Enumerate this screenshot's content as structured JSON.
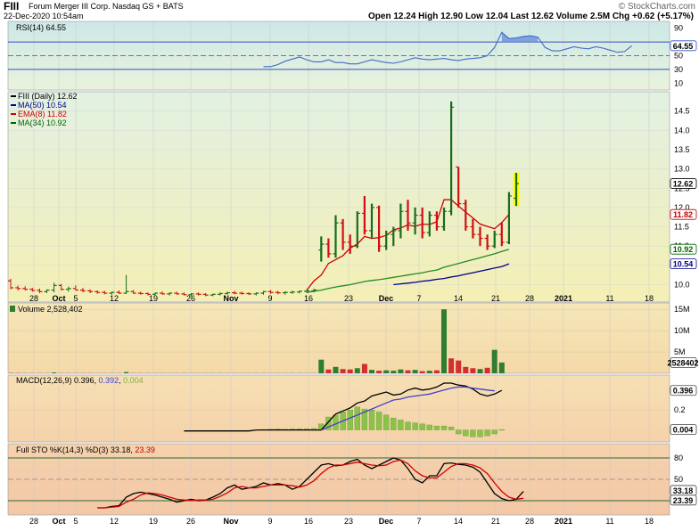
{
  "header": {
    "symbol": "FIII",
    "company": "Forum Merger III Corp. Nasdaq GS + BATS",
    "datetime": "22-Dec-2020 10:54am",
    "watermark": "© StockCharts.com",
    "quote_text": "Open 12.24 High 12.90 Low 12.04 Last 12.62 Volume 2.5M Chg +0.62 (+5.17%)",
    "chg_color": "#008000"
  },
  "x_axis": {
    "labels": [
      "28",
      "Oct",
      "5",
      "12",
      "19",
      "26",
      "Nov",
      "9",
      "16",
      "23",
      "Dec",
      "7",
      "14",
      "21",
      "28",
      "2021",
      "11",
      "18"
    ],
    "bold_labels": [
      "Oct",
      "Nov",
      "Dec",
      "2021"
    ]
  },
  "chart_data": [
    {
      "type": "line",
      "panel": "rsi",
      "legend": "RSI(14) 64.55",
      "y_ticks": [
        "90",
        "64.55",
        "50",
        "30",
        "10"
      ],
      "value_tag": "64.55",
      "ref_lines": [
        70,
        50,
        30
      ],
      "ylim": [
        0,
        100
      ],
      "x_start": 35,
      "series": [
        {
          "name": "RSI(14)",
          "color": "#4169c8",
          "values": [
            34,
            34,
            37,
            42,
            45,
            48,
            44,
            41,
            41,
            44,
            40,
            40,
            38,
            38,
            41,
            44,
            42,
            40,
            39,
            41,
            44,
            47,
            45,
            44,
            45,
            46,
            44,
            43,
            45,
            46,
            47,
            50,
            62,
            84,
            75,
            76,
            78,
            79,
            77,
            62,
            57,
            57,
            60,
            63,
            61,
            60,
            63,
            61,
            58,
            55,
            56,
            64.55
          ]
        }
      ]
    },
    {
      "type": "ohlc",
      "panel": "price",
      "title": "FIII (Daily) 12.62",
      "ylim": [
        9.55,
        15.0
      ],
      "y_ticks": [
        "14.5",
        "14.0",
        "13.5",
        "13.0",
        "12.5",
        "12.0",
        "11.5",
        "11.0",
        "10.5",
        "10.0"
      ],
      "value_tags": [
        {
          "text": "12.62",
          "color": "#000000",
          "border": "#000000",
          "value": 12.62
        },
        {
          "text": "11.82",
          "color": "#c00000",
          "border": "#c00000",
          "value": 11.82
        },
        {
          "text": "10.92",
          "color": "#006400",
          "border": "#006400",
          "value": 10.92
        },
        {
          "text": "10.54",
          "color": "#00008b",
          "border": "#00008b",
          "value": 10.54
        }
      ],
      "legend": [
        {
          "label": "FIII (Daily) 12.62",
          "color": "#000000"
        },
        {
          "label": "MA(50) 10.54",
          "color": "#00008b"
        },
        {
          "label": "EMA(8) 11.82",
          "color": "#d00000"
        },
        {
          "label": "MA(34) 10.92",
          "color": "#006400"
        }
      ],
      "bars": [
        [
          10.1,
          10.15,
          9.88,
          9.92
        ],
        [
          9.92,
          9.98,
          9.85,
          9.9
        ],
        [
          9.9,
          9.96,
          9.85,
          9.88
        ],
        [
          9.88,
          9.92,
          9.82,
          9.85
        ],
        [
          9.85,
          9.9,
          9.78,
          9.82
        ],
        [
          9.82,
          9.88,
          9.78,
          9.86
        ],
        [
          9.86,
          10.05,
          9.8,
          9.98
        ],
        [
          9.98,
          10.02,
          9.85,
          9.88
        ],
        [
          9.88,
          9.95,
          9.82,
          9.9
        ],
        [
          9.9,
          9.98,
          9.85,
          9.86
        ],
        [
          9.86,
          9.92,
          9.8,
          9.84
        ],
        [
          9.84,
          9.88,
          9.78,
          9.82
        ],
        [
          9.82,
          9.85,
          9.76,
          9.8
        ],
        [
          9.8,
          9.84,
          9.75,
          9.78
        ],
        [
          9.78,
          9.82,
          9.74,
          9.8
        ],
        [
          9.8,
          9.85,
          9.76,
          9.78
        ],
        [
          9.78,
          10.25,
          9.76,
          9.82
        ],
        [
          9.82,
          9.86,
          9.76,
          9.78
        ],
        [
          9.78,
          9.82,
          9.74,
          9.77
        ],
        [
          9.77,
          9.8,
          9.72,
          9.75
        ],
        [
          9.75,
          9.8,
          9.72,
          9.78
        ],
        [
          9.78,
          9.82,
          9.74,
          9.76
        ],
        [
          9.76,
          9.8,
          9.72,
          9.78
        ],
        [
          9.78,
          9.82,
          9.74,
          9.76
        ],
        [
          9.76,
          9.8,
          9.72,
          9.74
        ],
        [
          9.74,
          9.78,
          9.7,
          9.76
        ],
        [
          9.76,
          9.8,
          9.72,
          9.75
        ],
        [
          9.75,
          9.78,
          9.7,
          9.73
        ],
        [
          9.73,
          9.77,
          9.7,
          9.75
        ],
        [
          9.75,
          9.8,
          9.72,
          9.77
        ],
        [
          9.77,
          9.82,
          9.74,
          9.79
        ],
        [
          9.79,
          9.84,
          9.75,
          9.78
        ],
        [
          9.78,
          9.82,
          9.74,
          9.77
        ],
        [
          9.77,
          9.8,
          9.73,
          9.76
        ],
        [
          9.76,
          9.8,
          9.72,
          9.78
        ],
        [
          9.78,
          9.84,
          9.74,
          9.82
        ],
        [
          9.82,
          9.86,
          9.76,
          9.8
        ],
        [
          9.8,
          9.84,
          9.75,
          9.79
        ],
        [
          9.79,
          9.83,
          9.74,
          9.8
        ],
        [
          9.8,
          9.84,
          9.76,
          9.81
        ],
        [
          9.81,
          9.85,
          9.77,
          9.83
        ],
        [
          9.83,
          9.88,
          9.78,
          9.84
        ],
        [
          9.84,
          9.9,
          9.8,
          9.86
        ],
        [
          10.9,
          11.25,
          10.6,
          11.05
        ],
        [
          11.05,
          11.2,
          10.7,
          10.8
        ],
        [
          10.8,
          11.8,
          10.7,
          11.6
        ],
        [
          11.6,
          11.7,
          10.9,
          11.1
        ],
        [
          11.1,
          11.3,
          10.8,
          11.0
        ],
        [
          11.0,
          11.9,
          10.95,
          11.85
        ],
        [
          11.85,
          12.3,
          11.3,
          11.4
        ],
        [
          11.4,
          12.1,
          11.2,
          12.0
        ],
        [
          12.0,
          12.05,
          10.85,
          11.0
        ],
        [
          11.0,
          11.4,
          10.9,
          11.3
        ],
        [
          11.3,
          11.5,
          11.0,
          11.4
        ],
        [
          11.4,
          12.1,
          11.2,
          11.9
        ],
        [
          11.9,
          12.2,
          11.4,
          11.6
        ],
        [
          11.6,
          12.0,
          11.3,
          11.8
        ],
        [
          11.8,
          12.0,
          11.2,
          11.35
        ],
        [
          11.35,
          11.9,
          11.25,
          11.8
        ],
        [
          11.8,
          11.9,
          11.4,
          11.5
        ],
        [
          11.5,
          12.0,
          11.4,
          11.9
        ],
        [
          11.9,
          14.75,
          11.8,
          14.6
        ],
        [
          13.05,
          13.05,
          12.0,
          12.1
        ],
        [
          12.1,
          12.2,
          11.4,
          11.5
        ],
        [
          11.5,
          11.7,
          11.2,
          11.3
        ],
        [
          11.3,
          11.5,
          11.0,
          11.2
        ],
        [
          11.2,
          11.3,
          10.9,
          11.0
        ],
        [
          11.0,
          11.4,
          10.95,
          11.3
        ],
        [
          11.3,
          11.6,
          11.0,
          11.1
        ],
        [
          11.1,
          12.4,
          11.05,
          12.3
        ],
        [
          12.24,
          12.9,
          12.04,
          12.62
        ]
      ],
      "series": [
        {
          "name": "EMA(8)",
          "color": "#d00000",
          "start": 41,
          "values": [
            9.86,
            10.1,
            10.25,
            10.55,
            10.65,
            10.75,
            10.95,
            11.05,
            11.25,
            11.2,
            11.22,
            11.28,
            11.42,
            11.47,
            11.55,
            11.51,
            11.57,
            11.56,
            11.63,
            12.2,
            12.2,
            12.04,
            11.88,
            11.73,
            11.57,
            11.51,
            11.45,
            11.61,
            11.82
          ]
        },
        {
          "name": "MA(34)",
          "color": "#228b22",
          "start": 41,
          "values": [
            9.8,
            9.83,
            9.86,
            9.9,
            9.94,
            9.97,
            10.0,
            10.04,
            10.08,
            10.11,
            10.13,
            10.16,
            10.19,
            10.22,
            10.25,
            10.28,
            10.31,
            10.35,
            10.38,
            10.45,
            10.5,
            10.55,
            10.6,
            10.65,
            10.7,
            10.75,
            10.8,
            10.86,
            10.92
          ]
        },
        {
          "name": "MA(50)",
          "color": "#00008b",
          "start": 53,
          "values": [
            10.0,
            10.02,
            10.04,
            10.06,
            10.09,
            10.11,
            10.14,
            10.16,
            10.2,
            10.23,
            10.27,
            10.31,
            10.35,
            10.39,
            10.43,
            10.47,
            10.54
          ]
        }
      ]
    },
    {
      "type": "bar",
      "panel": "volume",
      "legend": "Volume 2,528,402",
      "ylim": [
        0,
        16500000
      ],
      "y_ticks": [
        "15M",
        "10M",
        "5M"
      ],
      "value_tag": "2528402",
      "start": 0,
      "values": [
        80000,
        60000,
        50000,
        40000,
        40000,
        40000,
        200000,
        50000,
        40000,
        40000,
        40000,
        40000,
        30000,
        30000,
        30000,
        30000,
        300000,
        40000,
        40000,
        30000,
        30000,
        30000,
        30000,
        30000,
        30000,
        30000,
        30000,
        30000,
        30000,
        30000,
        30000,
        30000,
        30000,
        30000,
        30000,
        30000,
        30000,
        30000,
        30000,
        30000,
        30000,
        30000,
        30000,
        3200000,
        900000,
        1500000,
        1000000,
        900000,
        1200000,
        2200000,
        800000,
        600000,
        700000,
        600000,
        900000,
        700000,
        800000,
        500000,
        600000,
        700000,
        15000000,
        3500000,
        3000000,
        1500000,
        1200000,
        1000000,
        1300000,
        5500000,
        2528402
      ],
      "up_color": "#2e7d32",
      "down_color": "#d32f2f",
      "up_flags": [
        0,
        0,
        1,
        0,
        0,
        1,
        1,
        0,
        1,
        0,
        0,
        0,
        0,
        0,
        1,
        0,
        1,
        0,
        0,
        0,
        1,
        0,
        1,
        0,
        0,
        1,
        0,
        0,
        1,
        1,
        1,
        0,
        0,
        0,
        1,
        1,
        0,
        0,
        1,
        1,
        1,
        1,
        1,
        1,
        0,
        1,
        0,
        0,
        1,
        0,
        1,
        0,
        1,
        1,
        1,
        0,
        1,
        0,
        1,
        0,
        1,
        0,
        0,
        0,
        0,
        1,
        0,
        1,
        1
      ]
    },
    {
      "type": "line",
      "panel": "macd",
      "legend_parts": [
        {
          "text": "MACD(12,26,9) 0.396, ",
          "color": "#000000"
        },
        {
          "text": "0.392",
          "color": "#4040d0"
        },
        {
          "text": ", ",
          "color": "#000000"
        },
        {
          "text": "0.004",
          "color": "#7cb342"
        }
      ],
      "ylim": [
        -0.12,
        0.55
      ],
      "y_ticks": [
        "0.396",
        "0.2",
        "0.004"
      ],
      "value_tags": [
        {
          "text": "0.396",
          "value": 0.396
        },
        {
          "text": "0.004",
          "value": 0.004
        }
      ],
      "histogram": {
        "color": "#8bc34a",
        "start": 35,
        "values": [
          0.005,
          0.008,
          0.01,
          0.008,
          0.01,
          0.012,
          0.012,
          0.015,
          0.06,
          0.13,
          0.15,
          0.18,
          0.2,
          0.23,
          0.21,
          0.2,
          0.18,
          0.15,
          0.12,
          0.1,
          0.08,
          0.07,
          0.06,
          0.05,
          0.04,
          0.04,
          0.03,
          -0.04,
          -0.06,
          -0.07,
          -0.07,
          -0.06,
          -0.04,
          0.004
        ]
      },
      "series": [
        {
          "name": "MACD",
          "color": "#000000",
          "start": 24,
          "values": [
            -0.01,
            -0.01,
            -0.01,
            -0.01,
            -0.01,
            -0.01,
            -0.01,
            -0.01,
            -0.01,
            -0.01,
            0.0,
            0.0,
            0.0,
            0.0,
            0.0,
            0.0,
            0.0,
            0.0,
            0.0,
            0.0,
            0.08,
            0.16,
            0.19,
            0.22,
            0.27,
            0.29,
            0.34,
            0.36,
            0.38,
            0.35,
            0.36,
            0.4,
            0.42,
            0.4,
            0.41,
            0.43,
            0.47,
            0.47,
            0.45,
            0.44,
            0.41,
            0.36,
            0.34,
            0.36,
            0.396
          ]
        },
        {
          "name": "Signal",
          "color": "#4040d0",
          "start": 43,
          "values": [
            0.0,
            0.03,
            0.06,
            0.09,
            0.12,
            0.15,
            0.18,
            0.21,
            0.24,
            0.27,
            0.3,
            0.31,
            0.33,
            0.34,
            0.35,
            0.36,
            0.38,
            0.4,
            0.42,
            0.43,
            0.43,
            0.42,
            0.41,
            0.4,
            0.392
          ]
        }
      ]
    },
    {
      "type": "line",
      "panel": "sto",
      "legend_parts": [
        {
          "text": "Full STO %K(14,3) %D(3) 33.18, ",
          "color": "#000000"
        },
        {
          "text": "23.39",
          "color": "#c00000"
        }
      ],
      "ylim": [
        0,
        100
      ],
      "ref_lines": [
        80,
        50,
        20
      ],
      "y_ticks": [
        "80",
        "50",
        "33.18",
        "23.39"
      ],
      "value_tags": [
        {
          "text": "33.18",
          "value": 33.18
        },
        {
          "text": "23.39",
          "value": 23.39
        }
      ],
      "series": [
        {
          "name": "%K",
          "color": "#000000",
          "start": 12,
          "values": [
            10,
            10,
            12,
            13,
            25,
            30,
            32,
            30,
            28,
            25,
            22,
            18,
            20,
            22,
            20,
            21,
            25,
            30,
            38,
            42,
            36,
            38,
            40,
            45,
            42,
            44,
            42,
            36,
            40,
            50,
            60,
            70,
            72,
            69,
            70,
            75,
            78,
            70,
            65,
            70,
            75,
            80,
            77,
            65,
            50,
            45,
            55,
            55,
            72,
            73,
            71,
            70,
            67,
            60,
            45,
            30,
            23,
            20,
            22,
            33.18
          ]
        },
        {
          "name": "%D",
          "color": "#d00000",
          "start": 12,
          "values": [
            10,
            10,
            11,
            12,
            18,
            22,
            28,
            31,
            30,
            28,
            25,
            22,
            21,
            20,
            21,
            21,
            22,
            26,
            31,
            38,
            40,
            38,
            38,
            40,
            42,
            42,
            42,
            41,
            39,
            42,
            48,
            58,
            66,
            70,
            70,
            72,
            74,
            72,
            70,
            69,
            70,
            75,
            77,
            72,
            62,
            55,
            52,
            52,
            60,
            68,
            72,
            72,
            70,
            66,
            58,
            45,
            33,
            25,
            22,
            23.39
          ]
        }
      ]
    }
  ]
}
